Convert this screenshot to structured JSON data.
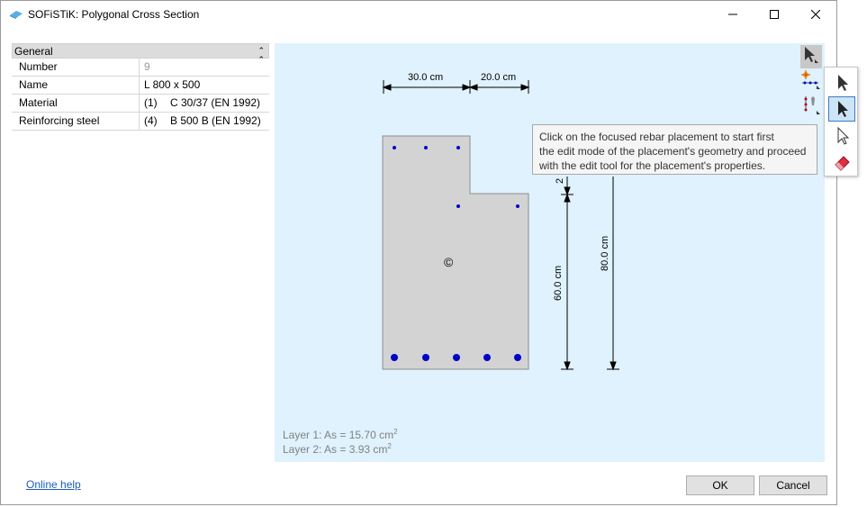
{
  "window": {
    "title": "SOFiSTiK: Polygonal Cross Section",
    "controls": [
      "minimize-icon",
      "maximize-icon",
      "close-icon"
    ]
  },
  "properties": {
    "group_label": "General",
    "rows": [
      {
        "name": "Number",
        "value": "9"
      },
      {
        "name": "Name",
        "value": "L 800 x 500"
      },
      {
        "name": "Material",
        "code": "(1)",
        "value": "C 30/37 (EN 1992)"
      },
      {
        "name": "Reinforcing steel",
        "code": "(4)",
        "value": "B 500 B (EN 1992)"
      }
    ]
  },
  "drawing": {
    "dims": {
      "top_left": "30.0 cm",
      "top_right": "20.0 cm",
      "small_vertical": "2",
      "vertical_60": "60.0 cm",
      "vertical_80": "80.0 cm"
    },
    "centroid_symbol": "©",
    "layer1": {
      "label": "Layer 1: As = 15.70 cm",
      "exp": "2"
    },
    "layer2": {
      "label": "Layer 2: As = 3.93 cm",
      "exp": "2"
    }
  },
  "tooltip": {
    "lines": [
      "Click on the focused rebar placement to start first",
      "the edit mode of the placement's geometry and proceed",
      "with the edit tool for the placement's properties."
    ]
  },
  "toolbar": {
    "icons": [
      "select-arrow-icon",
      "rebar-placement-icon",
      "rebar-properties-icon"
    ]
  },
  "flyout": {
    "icons": [
      "select-arrow-icon",
      "edit-geometry-arrow-icon",
      "edit-properties-arrow-icon",
      "eraser-icon"
    ]
  },
  "footer": {
    "help_label": "Online help",
    "ok_label": "OK",
    "cancel_label": "Cancel"
  },
  "colors": {
    "canvas_bg": "#dff2fd",
    "section_fill": "#d3d3d3",
    "rebar": "#0000c8",
    "link": "#1a5fb4"
  }
}
